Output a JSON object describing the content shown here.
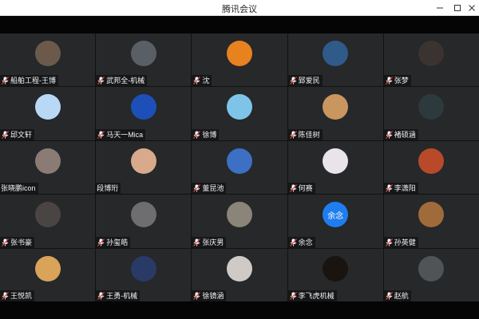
{
  "window": {
    "title": "腾讯会议",
    "min_icon": "minimize-icon",
    "max_icon": "maximize-icon",
    "close_icon": "close-icon"
  },
  "participants": [
    {
      "name": "船舶工程-王博",
      "mic": true,
      "avatar": "#6b5a4c"
    },
    {
      "name": "武邦全-机械",
      "mic": true,
      "avatar": "#5a5f66"
    },
    {
      "name": "沈",
      "mic": true,
      "avatar": "#e8821e"
    },
    {
      "name": "郅爱民",
      "mic": true,
      "avatar": "#2f5a8a"
    },
    {
      "name": "张梦",
      "mic": true,
      "avatar": "#3a3330"
    },
    {
      "name": "邱文轩",
      "mic": true,
      "avatar": "#b9d8f5"
    },
    {
      "name": "马天一Mica",
      "mic": true,
      "avatar": "#1d4fb8"
    },
    {
      "name": "徐博",
      "mic": true,
      "avatar": "#7ec4e8"
    },
    {
      "name": "陈佳树",
      "mic": true,
      "avatar": "#c99660"
    },
    {
      "name": "褚硕涵",
      "mic": true,
      "avatar": "#2c3a3e"
    },
    {
      "name": "张晓鹏icon",
      "mic": false,
      "avatar": "#8a7b74"
    },
    {
      "name": "段博珩",
      "mic": false,
      "avatar": "#d8a98a"
    },
    {
      "name": "董昆池",
      "mic": true,
      "avatar": "#3d6fc4"
    },
    {
      "name": "何赛",
      "mic": true,
      "avatar": "#e9e3ea"
    },
    {
      "name": "李潇阳",
      "mic": true,
      "avatar": "#b84a2a"
    },
    {
      "name": "张书豪",
      "mic": true,
      "avatar": "#4a4543"
    },
    {
      "name": "孙玺皓",
      "mic": true,
      "avatar": "#6e6e70"
    },
    {
      "name": "张庆男",
      "mic": true,
      "avatar": "#8b8478"
    },
    {
      "name": "余念",
      "mic": true,
      "avatar": "#1e7ef0",
      "initials": "余念"
    },
    {
      "name": "孙英健",
      "mic": true,
      "avatar": "#a06b3a"
    },
    {
      "name": "王悦凯",
      "mic": true,
      "avatar": "#d9a35a"
    },
    {
      "name": "王勇-机械",
      "mic": true,
      "avatar": "#2a3a66"
    },
    {
      "name": "徐镜涵",
      "mic": true,
      "avatar": "#cfcac6"
    },
    {
      "name": "李飞虎机械",
      "mic": true,
      "avatar": "#1a1410"
    },
    {
      "name": "赵航",
      "mic": true,
      "avatar": "#505457"
    }
  ]
}
